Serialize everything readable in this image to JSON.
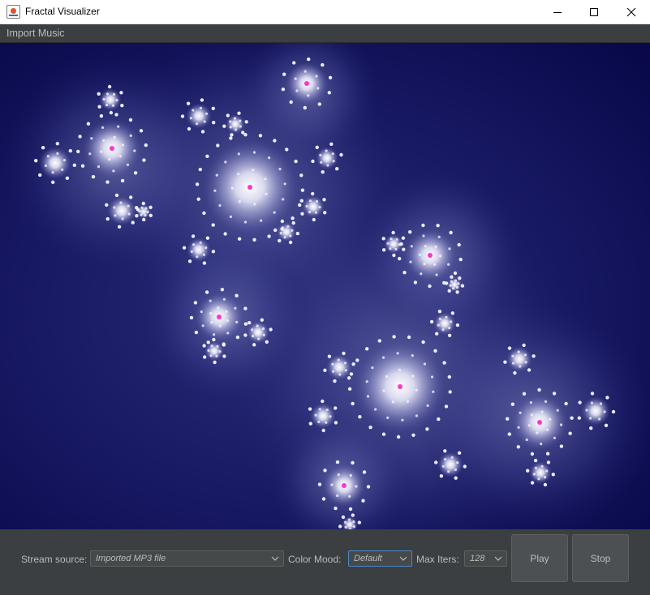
{
  "window": {
    "title": "Fractal Visualizer",
    "icon": "java-app-icon",
    "controls": [
      "minimize-icon",
      "maximize-icon",
      "close-icon"
    ]
  },
  "menu": {
    "items": [
      {
        "label": "Import Music"
      }
    ]
  },
  "visualizer": {
    "description_icon": "julia-set-fractal",
    "colors": {
      "background": "#0a0a4a",
      "glow": "#ffffff",
      "core": "#ff33cc"
    }
  },
  "controls": {
    "stream_source": {
      "label": "Stream source:",
      "value": "Imported MP3 file"
    },
    "color_mood": {
      "label": "Color Mood:",
      "value": "Default"
    },
    "max_iters": {
      "label": "Max Iters:",
      "value": "128"
    },
    "play_label": "Play",
    "stop_label": "Stop"
  }
}
